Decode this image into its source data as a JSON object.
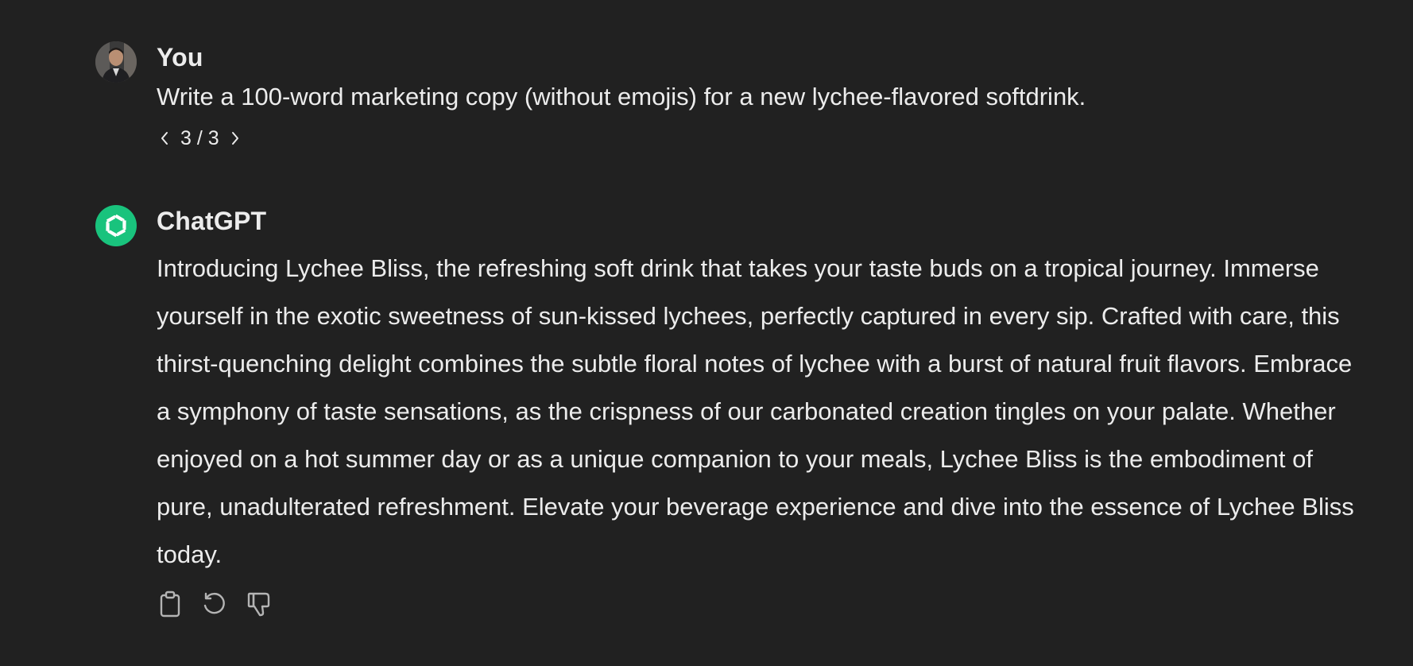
{
  "conversation": {
    "user": {
      "author": "You",
      "avatar_icon": "user-photo-avatar",
      "text": "Write a 100-word marketing copy (without emojis) for a new lychee-flavored softdrink.",
      "pager": "3 / 3"
    },
    "assistant": {
      "author": "ChatGPT",
      "avatar_icon": "openai-logo-icon",
      "avatar_color": "#19c37d",
      "text": "Introducing Lychee Bliss, the refreshing soft drink that takes your taste buds on a tropical journey. Immerse yourself in the exotic sweetness of sun-kissed lychees, perfectly captured in every sip. Crafted with care, this thirst-quenching delight combines the subtle floral notes of lychee with a burst of natural fruit flavors. Embrace a symphony of taste sensations, as the crispness of our carbonated creation tingles on your palate. Whether enjoyed on a hot summer day or as a unique companion to your meals, Lychee Bliss is the embodiment of pure, unadulterated refreshment. Elevate your beverage experience and dive into the essence of Lychee Bliss today.",
      "actions": [
        "clipboard-icon",
        "regenerate-icon",
        "thumbs-down-icon"
      ]
    }
  },
  "theme": {
    "background": "#212121",
    "text": "#ececec",
    "icon": "#b4b4b4"
  }
}
